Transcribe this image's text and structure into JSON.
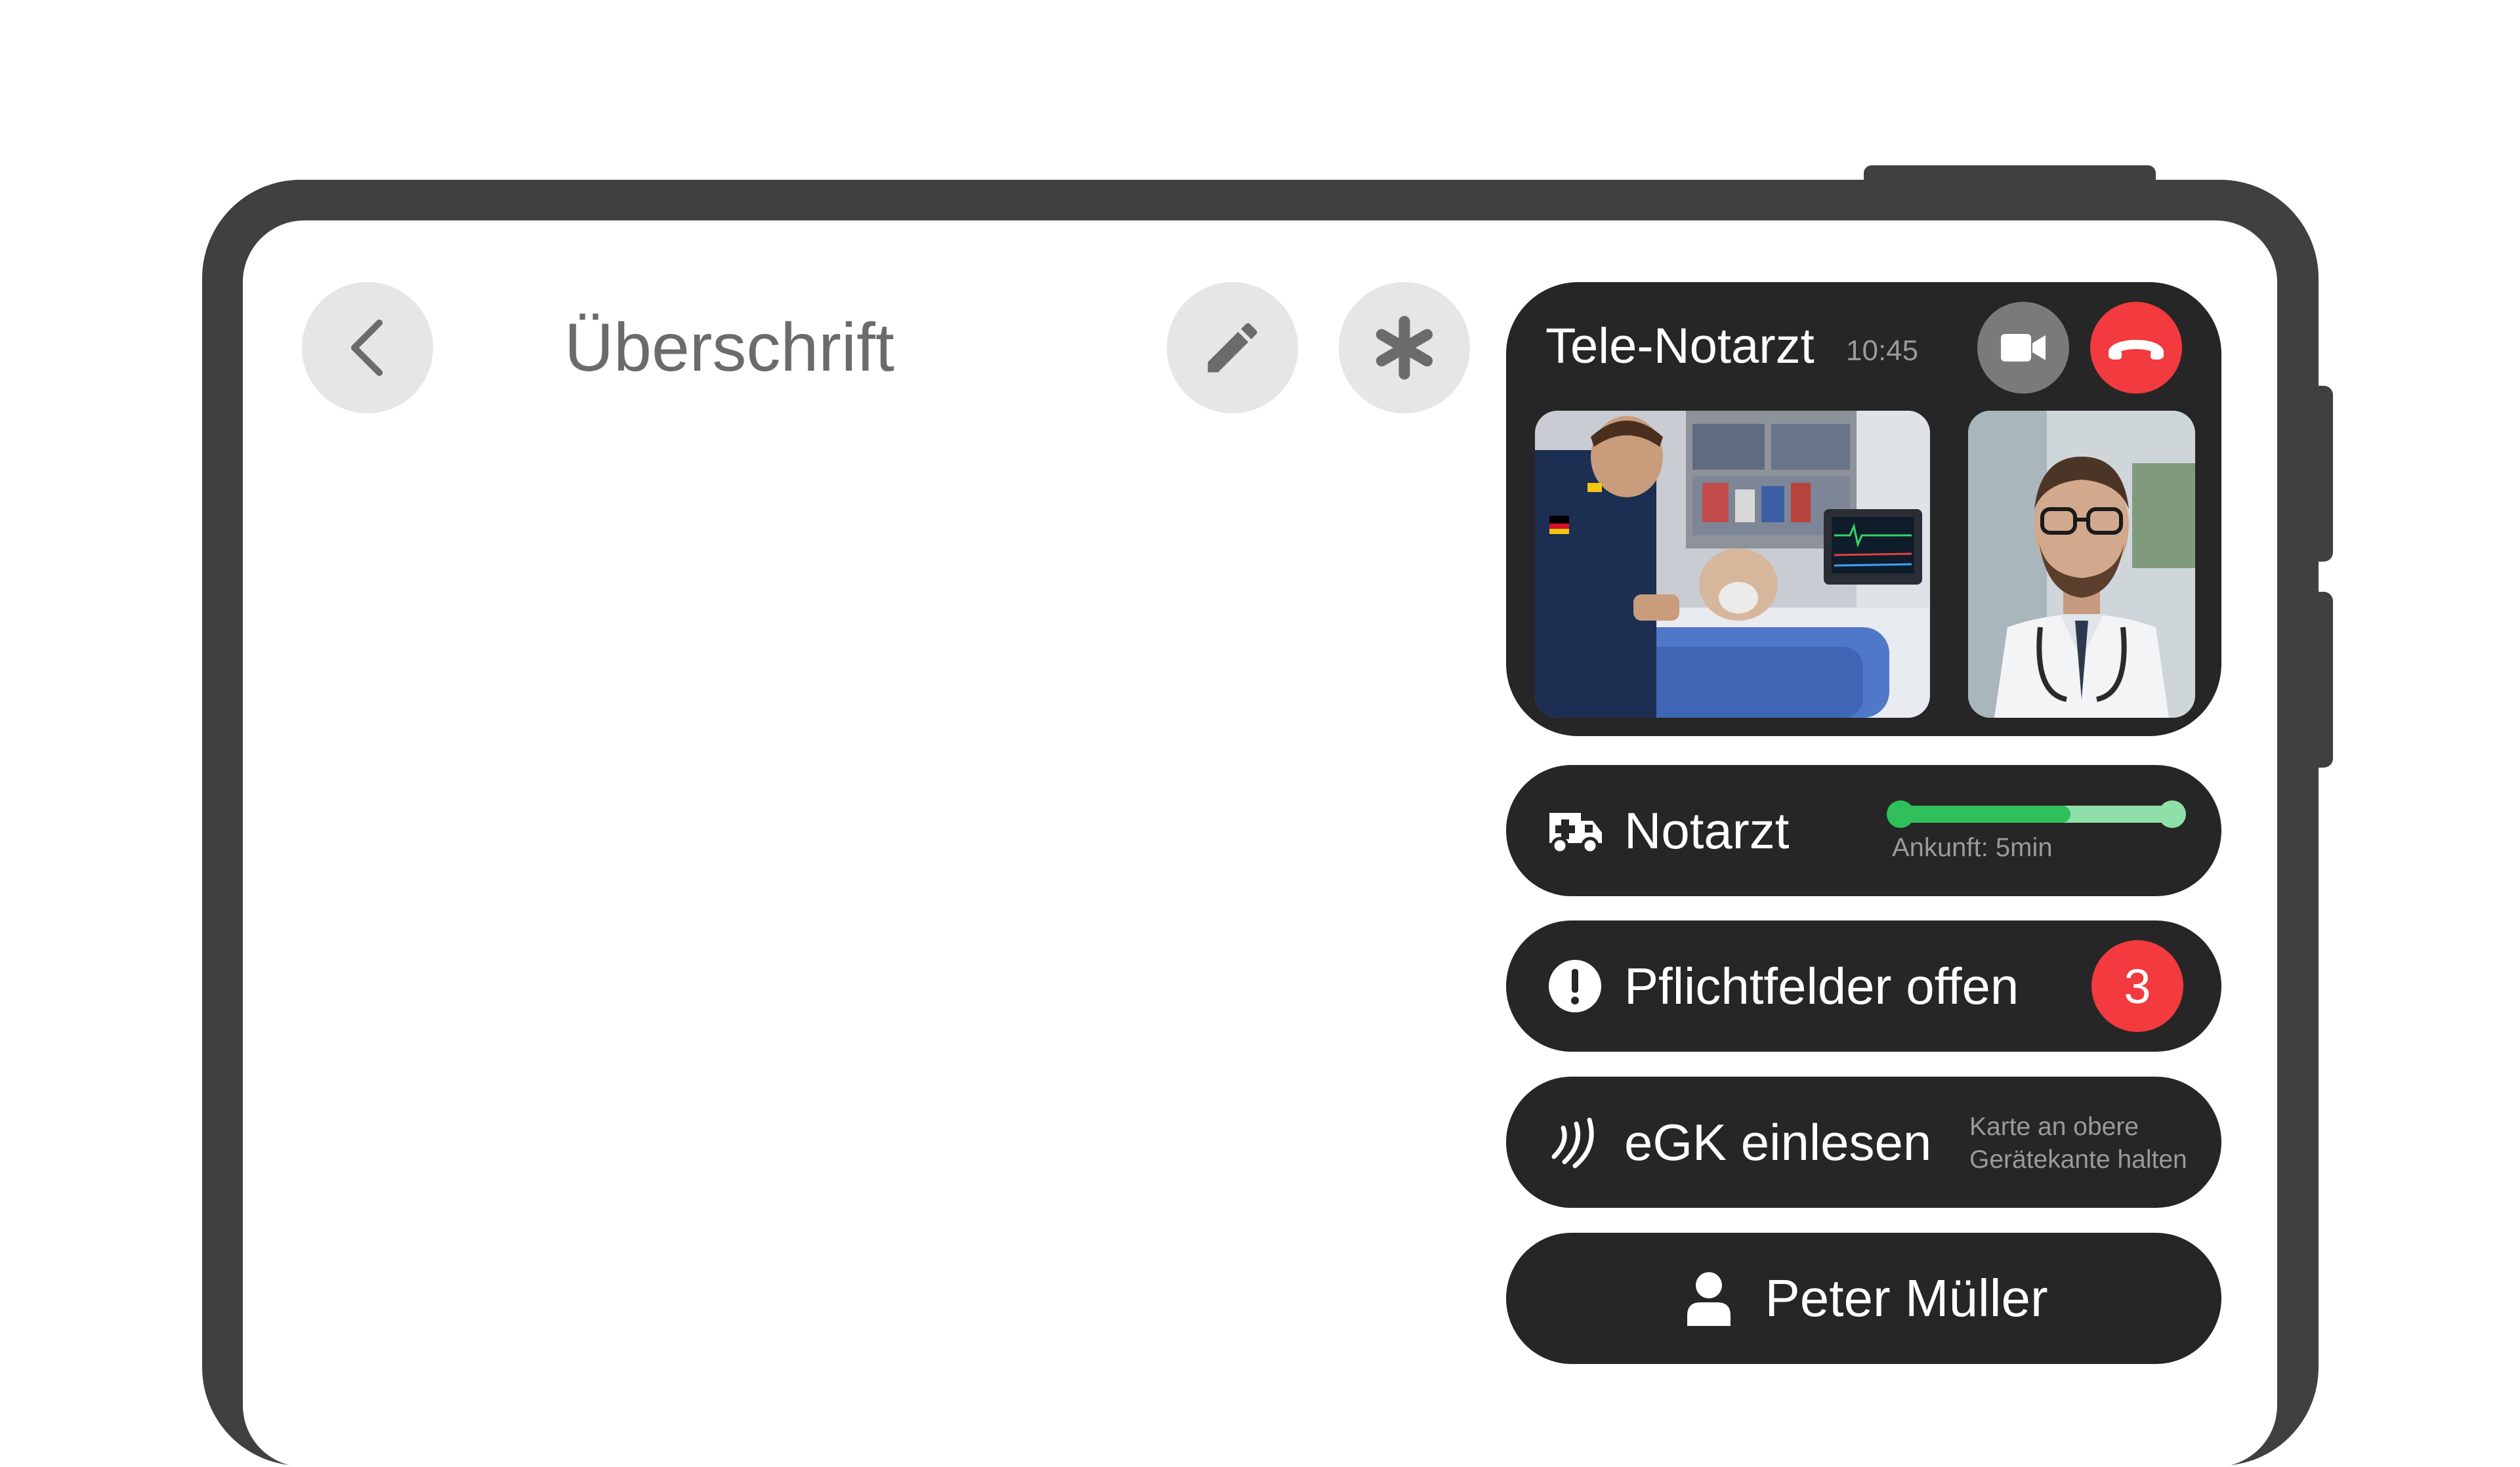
{
  "header": {
    "title": "Überschrift",
    "back_icon": "chevron-left-icon",
    "edit_icon": "pencil-icon",
    "star_icon": "asterisk-icon"
  },
  "call": {
    "title": "Tele-Notarzt",
    "time": "10:45",
    "video_icon": "video-camera-icon",
    "hangup_icon": "phone-hangup-icon",
    "hangup_color": "#f23a3f",
    "main_video": "paramedic-with-patient-in-ambulance",
    "self_video": "remote-doctor"
  },
  "eta": {
    "label": "Notarzt",
    "icon": "ambulance-icon",
    "caption": "Ankunft: 5min",
    "progress": 0.62,
    "color": "#2fbf5b",
    "track_color": "#8fe0a8"
  },
  "required": {
    "label": "Pflichtfelder offen",
    "icon": "exclamation-circle-icon",
    "count": "3",
    "badge_color": "#f23a3f"
  },
  "egk": {
    "label": "eGK einlesen",
    "icon": "nfc-icon",
    "hint": "Karte an obere Gerätekante halten"
  },
  "patient": {
    "name": "Peter Müller",
    "icon": "person-icon"
  },
  "colors": {
    "frame": "#404040",
    "card": "#262626",
    "button_bg": "#e6e6e6"
  }
}
